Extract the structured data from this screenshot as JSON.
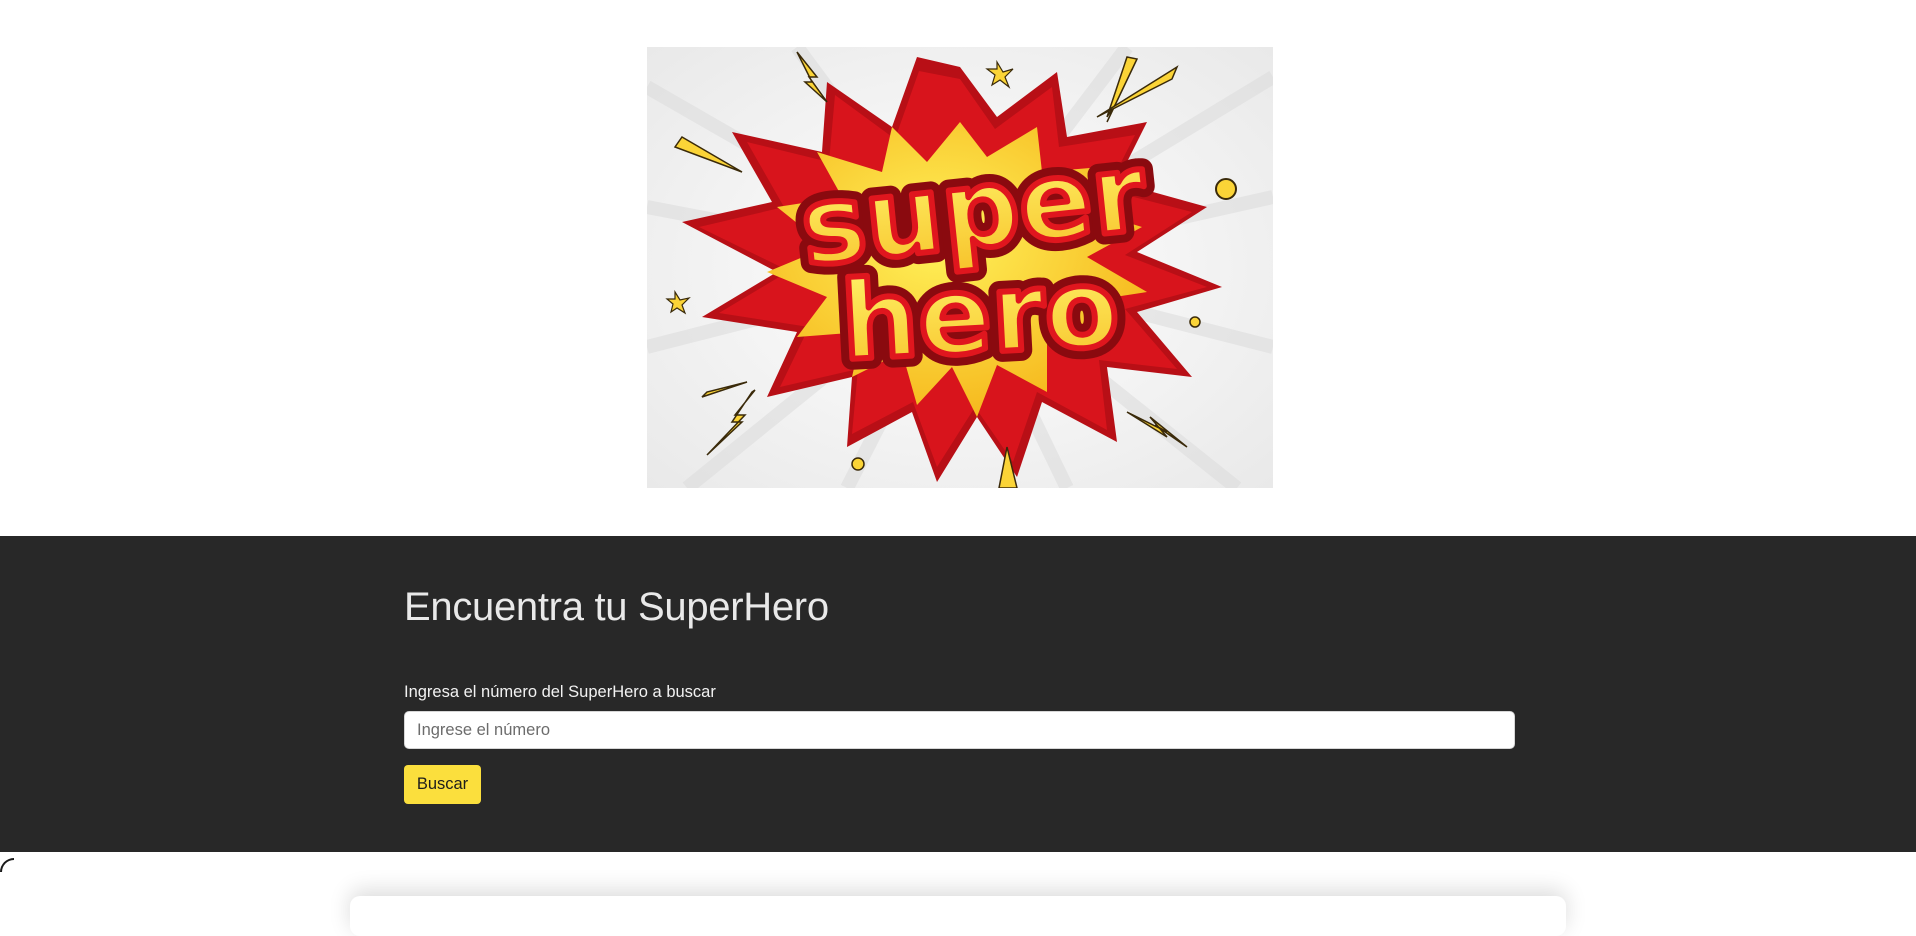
{
  "hero": {
    "logo_text_line1": "super",
    "logo_text_line2": "hero"
  },
  "search": {
    "title": "Encuentra tu SuperHero",
    "label": "Ingresa el número del SuperHero a buscar",
    "placeholder": "Ingrese el número",
    "value": "",
    "button_label": "Buscar"
  },
  "colors": {
    "section_bg": "#282828",
    "accent": "#fbdf3d",
    "burst_red": "#d8141c",
    "burst_yellow": "#fde23a"
  },
  "icons": [
    "superhero-logo"
  ]
}
